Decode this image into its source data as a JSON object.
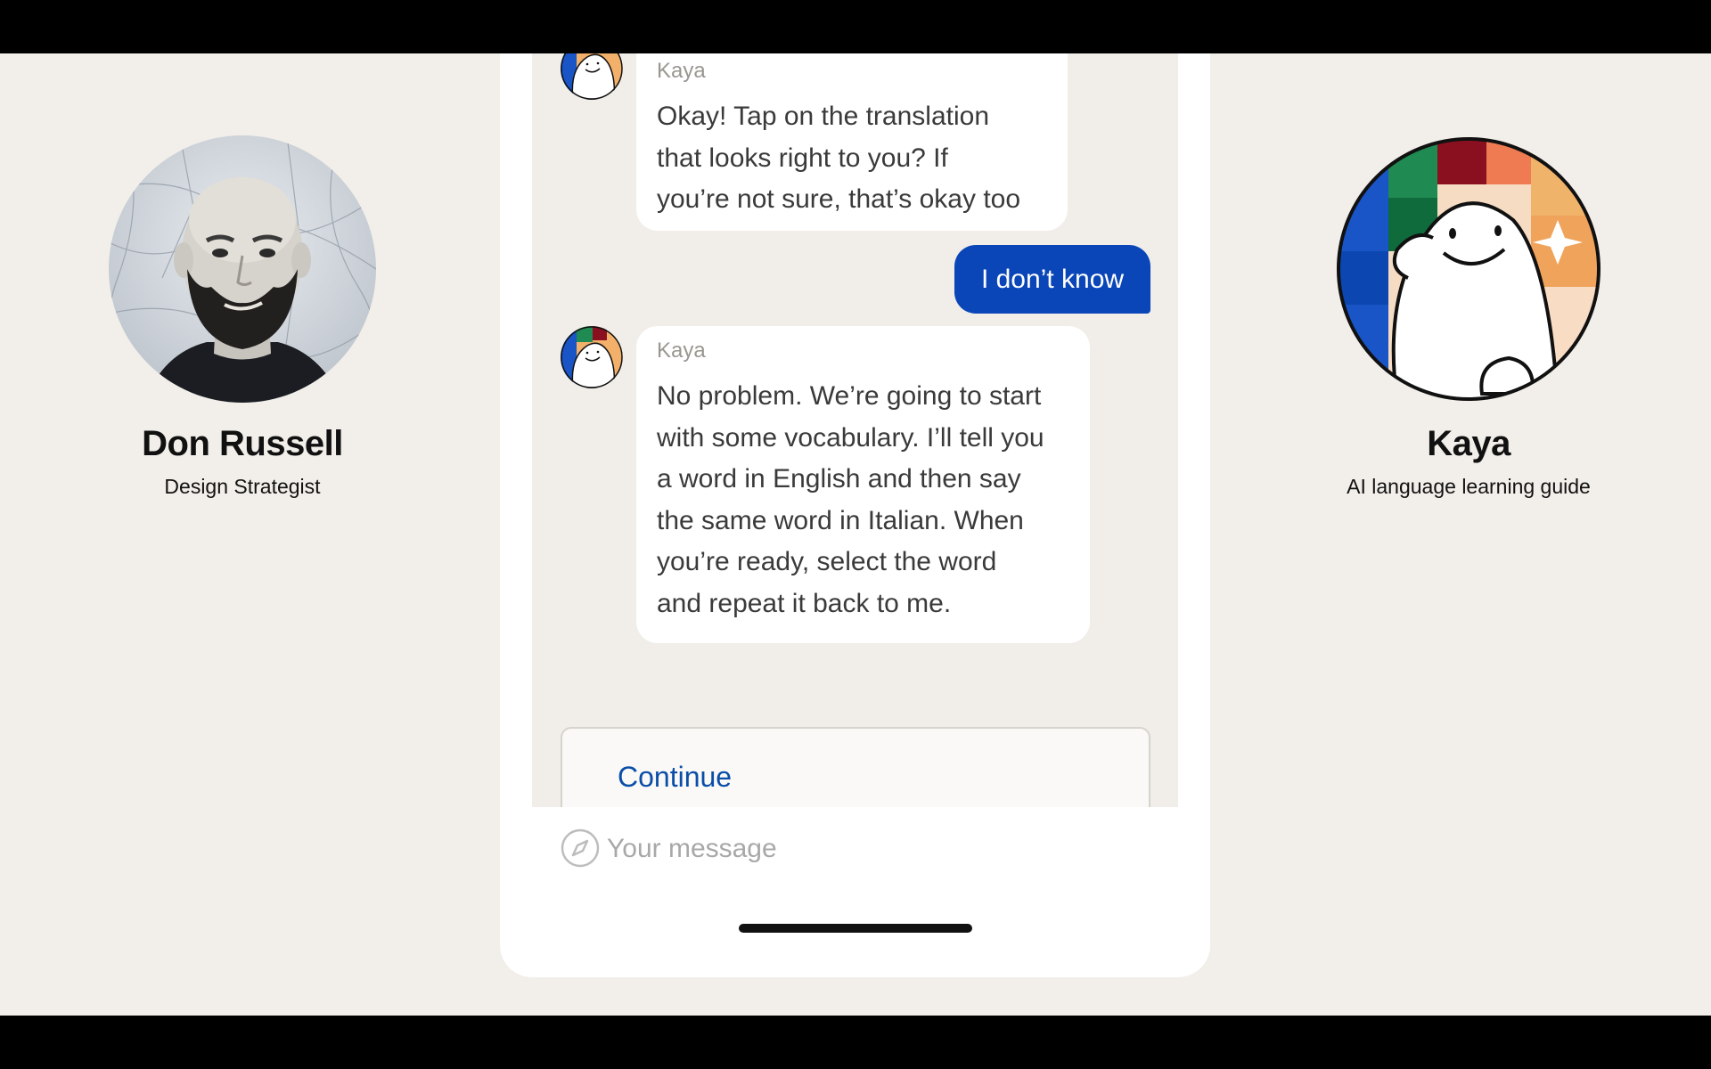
{
  "left_speaker": {
    "name": "Don Russell",
    "role": "Design Strategist"
  },
  "right_speaker": {
    "name": "Kaya",
    "role": "AI language learning guide"
  },
  "chat": {
    "messages": [
      {
        "sender": "Kaya",
        "text": "Okay! Tap on the translation\nthat looks right to you? If\nyou’re not sure, that’s okay too"
      },
      {
        "sender": "user",
        "text": "I don’t know"
      },
      {
        "sender": "Kaya",
        "text": "No problem. We’re going to start\nwith some vocabulary. I’ll tell you\na word in English and then say\nthe same word in Italian. When\nyou’re ready, select the word\nand repeat it back to me."
      }
    ],
    "continue_label": "Continue"
  },
  "composer": {
    "placeholder": "Your message",
    "icon": "compass-icon"
  },
  "colors": {
    "background": "#f2efea",
    "user_bubble": "#0a46b8",
    "link_blue": "#0b4ea8"
  }
}
